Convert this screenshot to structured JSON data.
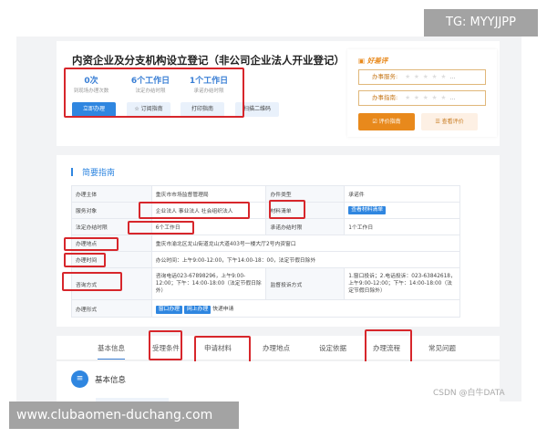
{
  "watermarks": {
    "top": "TG: MYYJJPP",
    "bottom": "www.clubaomen-duchang.com",
    "csdn": "CSDN @白牛DATA"
  },
  "header": {
    "title": "内资企业及分支机构设立登记（非公司企业法人开业登记）",
    "stats": [
      {
        "value": "0次",
        "label": "到现场办理次数"
      },
      {
        "value": "6个工作日",
        "label": "法定办结时限"
      },
      {
        "value": "1个工作日",
        "label": "承诺办结时限"
      }
    ],
    "buttons": {
      "apply": "立即办理",
      "subscribe": "订阅指南",
      "print": "打印指南",
      "qrcode": "扫描二维码"
    }
  },
  "rating": {
    "title": "好差评",
    "rows": [
      "办事服务:",
      "办事指南:"
    ],
    "more": "...",
    "evaluate": "评价指南",
    "view": "查看评价"
  },
  "guide": {
    "title": "简要指南",
    "rows": {
      "r1": {
        "k1": "办理主体",
        "v1": "重庆市市场监督管理局",
        "k2": "办件类型",
        "v2": "承诺件"
      },
      "r2": {
        "k1": "服务对象",
        "v1": "企业法人 事业法人 社会组织法人",
        "k2": "材料清单",
        "v2": "查看材料清单"
      },
      "r3": {
        "k1": "法定办结时限",
        "v1": "6个工作日",
        "k2": "承诺办结时限",
        "v2": "1个工作日"
      },
      "r4": {
        "k1": "办理地点",
        "v1": "重庆市渝北区龙山街道龙山大道403号一楼大厅2号内资窗口"
      },
      "r5": {
        "k1": "办理时间",
        "v1": "办公时间：上午9:00-12:00，下午14:00-18：00，法定节假日除外"
      },
      "r6": {
        "k1": "咨询方式",
        "v1": "咨询电话023-67898296，上午9:00-12:00；下午：14:00-18:00（法定节假日除外）",
        "k2": "监督投诉方式",
        "v2": "1.窗口投诉；2.电话投诉：023-63842618，上午9:00-12:00；下午：14:00-18:00（法定节假日除外）"
      },
      "r7": {
        "k1": "办理形式",
        "t1": "窗口办理",
        "t2": "网上办理",
        "t3": "快递申请"
      }
    }
  },
  "tabs": [
    "基本信息",
    "受理条件",
    "申请材料",
    "办理地点",
    "设定依据",
    "办理流程",
    "常见问题"
  ],
  "section": {
    "title": "基本信息"
  },
  "colors": {
    "accent": "#2f86e0",
    "highlight": "#d7262b",
    "rating": "#e8891c"
  }
}
